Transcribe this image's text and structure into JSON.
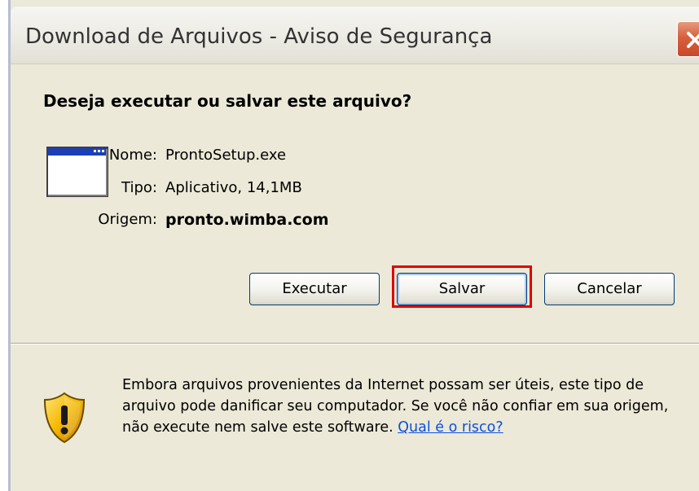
{
  "window": {
    "title": "Download de Arquivos - Aviso de Segurança",
    "close_symbol": "close-icon"
  },
  "dialog": {
    "question": "Deseja executar ou salvar este arquivo?",
    "file_icon": "application-window-icon",
    "fields": [
      {
        "label": "Nome:",
        "value": "ProntoSetup.exe"
      },
      {
        "label": "Tipo:",
        "value": "Aplicativo, 14,1MB"
      },
      {
        "label": "Origem:",
        "value": "pronto.wimba.com"
      }
    ]
  },
  "buttons": {
    "run": "Executar",
    "save": "Salvar",
    "cancel": "Cancelar"
  },
  "warning": {
    "icon": "security-shield-icon",
    "text": "Embora arquivos provenientes da Internet possam ser úteis, este tipo de arquivo pode danificar seu computador. Se você não confiar em sua origem, não execute nem salve este software.",
    "link": "Qual é o risco?"
  },
  "colors": {
    "dialog_bg": "#ece9d8",
    "highlight": "#e00000",
    "link": "#0b4fdc",
    "close_button": "#d5603e"
  }
}
